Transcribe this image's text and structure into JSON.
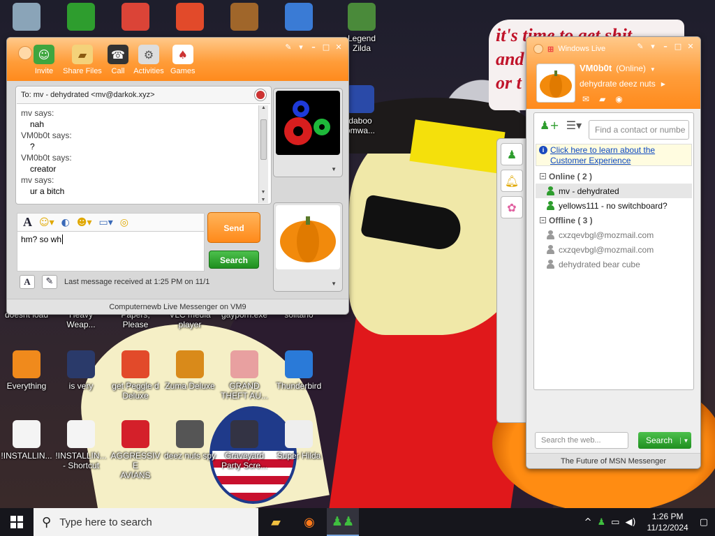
{
  "wallpaper": {
    "bubble_text": [
      "it's time to get shit",
      "and",
      "or t"
    ]
  },
  "desktop_icons": [
    {
      "id": "recycle",
      "label": "",
      "icon": "recycle-bin-icon",
      "color": "#8aa4b8"
    },
    {
      "id": "msn-top",
      "label": "",
      "icon": "msn-messenger-icon",
      "color": "#2e9d2e"
    },
    {
      "id": "chrome",
      "label": "",
      "icon": "chrome-icon",
      "color": "#db4437"
    },
    {
      "id": "peggle-top",
      "label": "",
      "icon": "peggle-icon",
      "color": "#e24a2a"
    },
    {
      "id": "papers-top",
      "label": "",
      "icon": "papers-please-icon",
      "color": "#a0662a"
    },
    {
      "id": "winlogo",
      "label": "",
      "icon": "windows-update-icon",
      "color": "#3a7bd5"
    },
    {
      "id": "zilda",
      "label": "Legend\nZilda",
      "icon": "game-character-icon",
      "color": "#4a8a3a"
    },
    {
      "id": "doesnt-load",
      "label": "doesnt load",
      "icon": "",
      "color": ""
    },
    {
      "id": "heavy",
      "label": "Heavy\nWeap...",
      "icon": "",
      "color": ""
    },
    {
      "id": "papers",
      "label": "Papers, Please",
      "icon": "",
      "color": ""
    },
    {
      "id": "vlc",
      "label": "VLC media\nplayer",
      "icon": "",
      "color": ""
    },
    {
      "id": "gayporn",
      "label": "gayporn.exe",
      "icon": "",
      "color": ""
    },
    {
      "id": "solitario",
      "label": "solitario",
      "icon": "",
      "color": ""
    },
    {
      "id": "everything",
      "label": "Everything",
      "icon": "search-ring-icon",
      "color": "#f08a1c"
    },
    {
      "id": "isvery",
      "label": "is very",
      "icon": "shield-emblem-icon",
      "color": "#2a3a6a"
    },
    {
      "id": "peggle",
      "label": "get Peggle d\nDeluxe",
      "icon": "peggle-icon",
      "color": "#e24a2a"
    },
    {
      "id": "zuma",
      "label": "Zuma Deluxe",
      "icon": "zuma-icon",
      "color": "#d98a1a"
    },
    {
      "id": "gta",
      "label": "GRAND\nTHEFT AU...",
      "icon": "anime-girl-icon",
      "color": "#e8a0a0"
    },
    {
      "id": "thunderbird",
      "label": "Thunderbird",
      "icon": "thunderbird-icon",
      "color": "#2a7ad8"
    },
    {
      "id": "installing",
      "label": "!INSTALLIN...",
      "icon": "document-icon",
      "color": "#f4f4f4"
    },
    {
      "id": "installing-sc",
      "label": "!INSTALLIN...\n- Shortcut",
      "icon": "document-icon",
      "color": "#f4f4f4"
    },
    {
      "id": "angry",
      "label": "AGGRESSIVE\nAVIANS",
      "icon": "angry-bird-icon",
      "color": "#d4202a"
    },
    {
      "id": "deeznuts",
      "label": "deez nuts spy",
      "icon": "windows-stack-icon",
      "color": "#555"
    },
    {
      "id": "graveyard",
      "label": "Graveyard\nParty Scre...",
      "icon": "skeleton-icon",
      "color": "#334"
    },
    {
      "id": "hilda",
      "label": "Super Hilda",
      "icon": "pixel-dog-icon",
      "color": "#eee"
    },
    {
      "id": "shma",
      "label": "daboo\nomwa...",
      "icon": "shield-icon",
      "color": "#2a4aa8"
    }
  ],
  "conversation": {
    "toolbar": [
      {
        "label": "Invite",
        "icon": "invite-icon"
      },
      {
        "label": "Share Files",
        "icon": "folder-icon"
      },
      {
        "label": "Call",
        "icon": "phone-icon"
      },
      {
        "label": "Activities",
        "icon": "activities-icon"
      },
      {
        "label": "Games",
        "icon": "cards-icon"
      }
    ],
    "to_line": "To:  mv - dehydrated  <mv@darkok.xyz>",
    "to_name": "mv",
    "messages": [
      {
        "says": "mv says:",
        "text": "nah"
      },
      {
        "says": "VM0b0t says:",
        "text": "?"
      },
      {
        "says": "VM0b0t says:",
        "text": "creator"
      },
      {
        "says": "mv says:",
        "text": "ur a bitch"
      }
    ],
    "input_text": "hm? so wh",
    "send_label": "Send",
    "search_label": "Search",
    "last_message": "Last message received at 1:25 PM on 11/1",
    "footer": "Computernewb Live Messenger on VM9"
  },
  "contacts": {
    "title": "Windows Live",
    "display_name": "VM0b0t",
    "status": "(Online)",
    "personal_message": "dehydrate deez nuts",
    "search_placeholder": "Find a contact or numbe",
    "info_link": "Click here to learn about the Customer Experience",
    "groups": [
      {
        "label": "Online ( 2 )",
        "items": [
          {
            "name": "mv - dehydrated",
            "online": true,
            "selected": true
          },
          {
            "name": "yellows111 - no switchboard?",
            "online": true,
            "selected": false
          }
        ]
      },
      {
        "label": "Offline ( 3 )",
        "items": [
          {
            "name": "cxzqevbgl@mozmail.com",
            "online": false,
            "selected": false
          },
          {
            "name": "cxzqevbgl@mozmail.com",
            "online": false,
            "selected": false
          },
          {
            "name": "dehydrated bear cube",
            "online": false,
            "selected": false
          }
        ]
      }
    ],
    "web_search_placeholder": "Search the web...",
    "web_search_button": "Search",
    "footer": "The Future of MSN Messenger"
  },
  "taskbar": {
    "search_placeholder": "Type here to search",
    "time": "1:26 PM",
    "date": "11/12/2024"
  },
  "colors": {
    "msn_orange": "#ff9d3a",
    "online_green": "#2e9d2e",
    "offline_grey": "#9a9a9a"
  }
}
